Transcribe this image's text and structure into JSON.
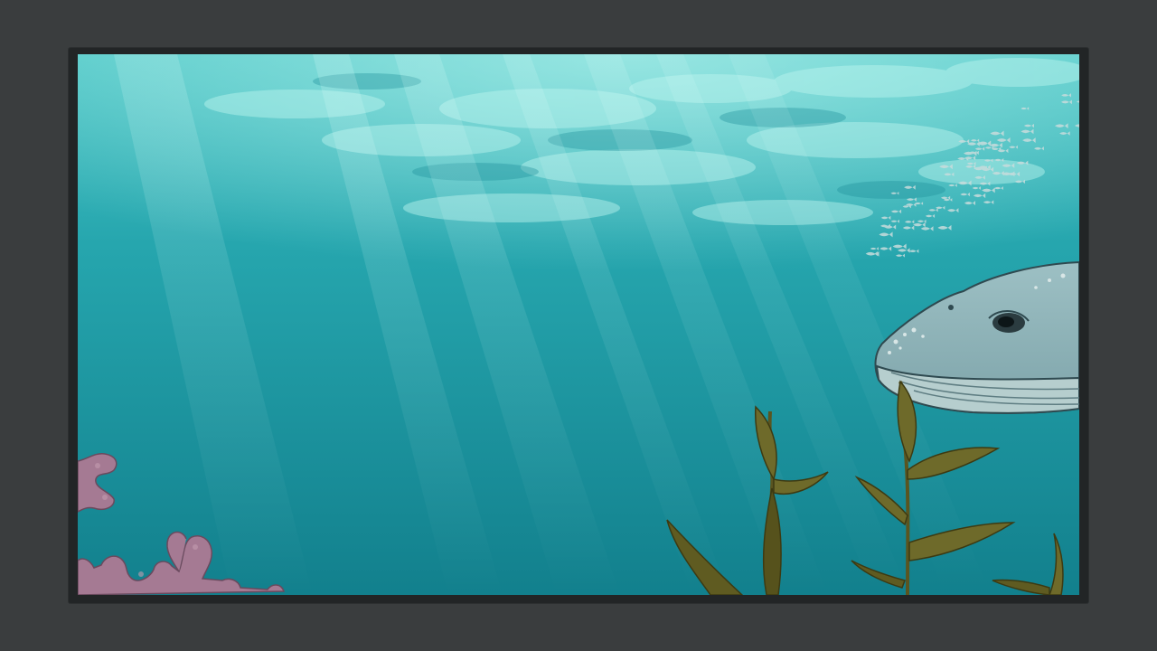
{
  "player": {
    "background_color": "#3a3d3e",
    "frame_color": "#222526"
  },
  "scene": {
    "subject": "underwater-ocean-scene",
    "colors": {
      "surface_light": "#8fe6e2",
      "water_mid": "#23a0a8",
      "water_deep": "#137f8c",
      "whale_body": "#8fb3b8",
      "whale_belly": "#b9d0d0",
      "coral": "#a87a90",
      "kelp": "#6e6a2a"
    },
    "elements": [
      "light-rays-icon",
      "fish-school-icon",
      "whale-icon",
      "coral-icon",
      "kelp-icon"
    ]
  }
}
